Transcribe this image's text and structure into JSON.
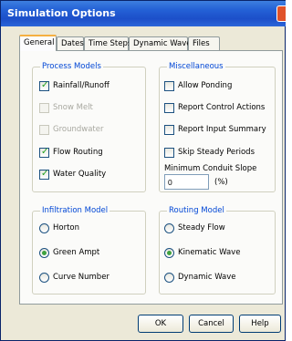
{
  "window": {
    "title": "Simulation Options"
  },
  "tabs": [
    "General",
    "Dates",
    "Time Steps",
    "Dynamic Wave",
    "Files"
  ],
  "process_models": {
    "title": "Process Models",
    "items": [
      {
        "label": "Rainfall/Runoff",
        "checked": true,
        "enabled": true
      },
      {
        "label": "Snow Melt",
        "checked": false,
        "enabled": false
      },
      {
        "label": "Groundwater",
        "checked": false,
        "enabled": false
      },
      {
        "label": "Flow Routing",
        "checked": true,
        "enabled": true
      },
      {
        "label": "Water Quality",
        "checked": true,
        "enabled": true
      }
    ]
  },
  "miscellaneous": {
    "title": "Miscellaneous",
    "items": [
      {
        "label": "Allow Ponding",
        "checked": false
      },
      {
        "label": "Report Control Actions",
        "checked": false
      },
      {
        "label": "Report Input Summary",
        "checked": false
      },
      {
        "label": "Skip Steady Periods",
        "checked": false
      }
    ],
    "min_slope_label": "Minimum Conduit Slope",
    "min_slope_value": "0",
    "min_slope_unit": "(%)"
  },
  "infiltration": {
    "title": "Infiltration Model",
    "options": [
      "Horton",
      "Green Ampt",
      "Curve Number"
    ],
    "selected": "Green Ampt"
  },
  "routing": {
    "title": "Routing Model",
    "options": [
      "Steady Flow",
      "Kinematic Wave",
      "Dynamic Wave"
    ],
    "selected": "Kinematic Wave"
  },
  "buttons": {
    "ok": "OK",
    "cancel": "Cancel",
    "help": "Help"
  },
  "colors": {
    "titlebar": "#2461d6",
    "group_title": "#0046d5",
    "tab_highlight": "#f5b042"
  }
}
